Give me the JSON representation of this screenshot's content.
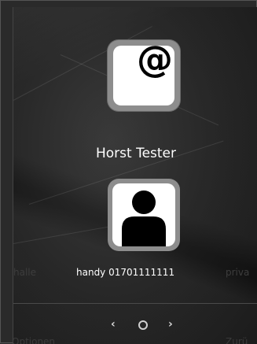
{
  "screen": {
    "app_icon": {
      "name": "at-sign-icon",
      "glyph": "@"
    },
    "contact_name": "Horst Tester",
    "avatar": {
      "name": "person-avatar-icon"
    },
    "carousel": {
      "previous_label": "halle",
      "current_label": "handy 01701111111",
      "next_label": "priva"
    },
    "navigation": {
      "prev_glyph": "‹",
      "next_glyph": "›"
    },
    "softkeys": {
      "left_label": "Optionen",
      "right_label": "Zurü"
    }
  },
  "colors": {
    "background": "#1a1a1a",
    "text_primary": "#ffffff",
    "text_dim": "#3d3d3d",
    "icon_border": "#8d8d8d"
  }
}
